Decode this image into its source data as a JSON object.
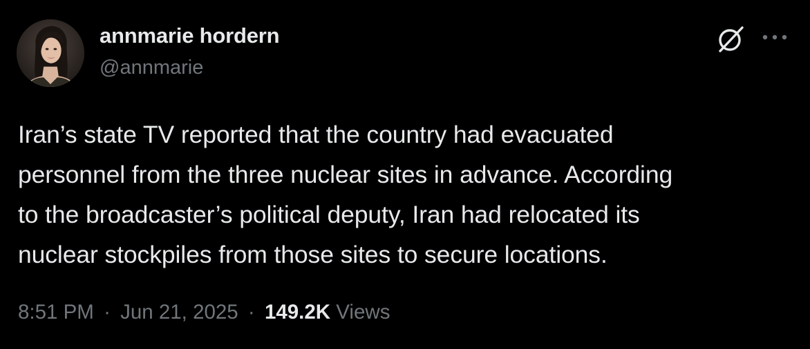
{
  "author": {
    "display_name": "annmarie hordern",
    "handle": "@annmarie"
  },
  "post": {
    "text_lines": [
      "Iran’s state TV reported that the country had evacuated",
      "personnel from the three nuclear sites in advance. According",
      "to the broadcaster’s political deputy, Iran had relocated its",
      "nuclear stockpiles from those sites to secure locations."
    ],
    "time": "8:51 PM",
    "date": "Jun 21, 2025",
    "separator": "·",
    "views_count": "149.2K",
    "views_label": "Views"
  },
  "icons": {
    "grok": "grok-icon",
    "more": "more-icon"
  },
  "colors": {
    "background": "#000000",
    "primary_text": "#e7e9ea",
    "secondary_text": "#71767b"
  }
}
